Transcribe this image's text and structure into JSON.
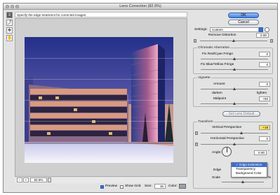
{
  "window": {
    "title": "Lens Correction (82.9%)"
  },
  "hint": "Specify the edge treatment for corrected images.",
  "tools": [
    {
      "name": "remove-distortion-tool-icon",
      "glyph": "≡"
    },
    {
      "name": "straighten-tool-icon",
      "glyph": "⤴"
    },
    {
      "name": "move-grid-tool-icon",
      "glyph": "✥"
    },
    {
      "name": "hand-tool-icon",
      "glyph": "✋"
    },
    {
      "name": "zoom-tool-icon",
      "glyph": "🔍"
    }
  ],
  "bottom": {
    "minus": "−",
    "plus": "+",
    "zoom": "82.9%"
  },
  "options": {
    "preview_label": "Preview",
    "show_grid_label": "Show Grid",
    "size_label": "Size:",
    "size_value": "16",
    "color_label": "Color:"
  },
  "buttons": {
    "ok": "OK",
    "cancel": "Cancel"
  },
  "settings": {
    "label": "Settings:",
    "value": "Custom"
  },
  "remove_distortion": {
    "label": "Remove Distortion",
    "value": "0.00"
  },
  "chromatic": {
    "title": "Chromatic Aberration",
    "red_cyan_label": "Fix Red/Cyan Fringe",
    "red_cyan_value": "0",
    "blue_yellow_label": "Fix Blue/Yellow Fringe",
    "blue_yellow_value": "0"
  },
  "vignette": {
    "title": "Vignette",
    "amount_label": "Amount",
    "amount_value": "0",
    "darken": "darken",
    "lighten": "lighten",
    "midpoint_label": "Midpoint",
    "midpoint_value": "+50"
  },
  "set_lens_default": "Set Lens Default",
  "transform": {
    "title": "Transform",
    "vertical_label": "Vertical Perspective",
    "vertical_value": "+19",
    "horizontal_label": "Horizontal Perspective",
    "horizontal_value": "0",
    "angle_label": "Angle:",
    "angle_value": "0.00",
    "angle_unit": "°",
    "edge_label": "Edge",
    "scale_label": "Scale",
    "scale_unit": "%"
  },
  "edge_menu": {
    "items": [
      "Edge Extension",
      "Transparency",
      "Background Color"
    ],
    "selected": "Edge Extension"
  },
  "colors": {
    "accent": "#3b6fd4",
    "highlight_field": "#ffe45c"
  }
}
